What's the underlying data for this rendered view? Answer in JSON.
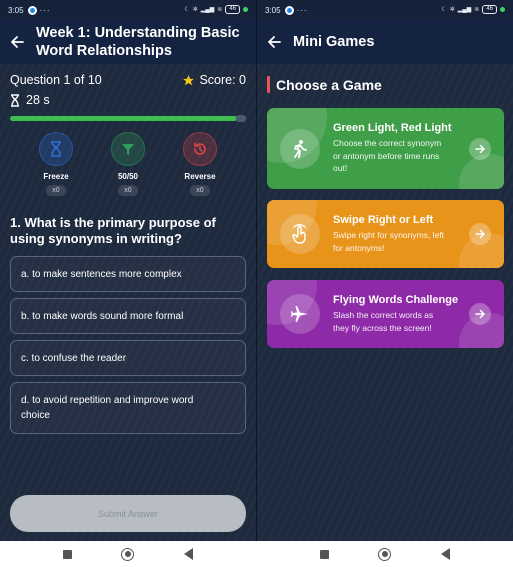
{
  "quiz_screen": {
    "status_bar": {
      "time": "3:05",
      "battery": "46"
    },
    "header": {
      "title_line1": "Week 1: Understanding Basic",
      "title_line2": "Word Relationships"
    },
    "question_counter": "Question 1 of 10",
    "score_label": "Score: 0",
    "timer": "28 s",
    "timer_progress": 0.96,
    "powerups": [
      {
        "label": "Freeze",
        "count": "x0",
        "icon": "hourglass-icon",
        "color": "#2f6fd6"
      },
      {
        "label": "50/50",
        "count": "x0",
        "icon": "filter-icon",
        "color": "#2f9e5a"
      },
      {
        "label": "Reverse",
        "count": "x0",
        "icon": "history-icon",
        "color": "#d84545"
      }
    ],
    "question_line1": "1. What is the primary purpose of",
    "question_line2": "using synonyms in writing?",
    "options": [
      {
        "line1": "a. to make sentences more complex",
        "line2": ""
      },
      {
        "line1": "b. to make words sound more formal",
        "line2": ""
      },
      {
        "line1": "c. to confuse the reader",
        "line2": ""
      },
      {
        "line1": "d. to avoid repetition and improve word",
        "line2": "choice"
      }
    ],
    "submit_label": "Submit Answer"
  },
  "games_screen": {
    "status_bar": {
      "time": "3:05",
      "battery": "46"
    },
    "header": {
      "title": "Mini Games"
    },
    "section_title": "Choose a Game",
    "games": [
      {
        "title": "Green Light, Red Light",
        "desc_lines": [
          "Choose the correct synonym",
          "or antonym before time runs",
          "out!"
        ],
        "icon": "walking-person-icon",
        "color": "#3f9e48"
      },
      {
        "title": "Swipe Right or Left",
        "desc_lines": [
          "Swipe right for synonyms, left",
          "for antonyms!"
        ],
        "icon": "swipe-hand-icon",
        "color": "#e8931a"
      },
      {
        "title": "Flying Words Challenge",
        "desc_lines": [
          "Slash the correct words as",
          "they fly across the screen!"
        ],
        "icon": "airplane-icon",
        "color": "#8e2aa8"
      }
    ]
  },
  "colors": {
    "background": "#1e2a3e",
    "appbar": "#152342",
    "progress": "#3fbf4f",
    "star": "#f5c518",
    "accent_bar": "#e85555"
  }
}
